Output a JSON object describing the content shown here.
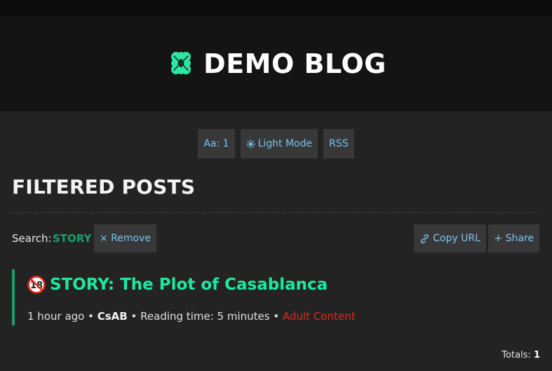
{
  "header": {
    "title": "DEMO BLOG",
    "logo_icon": "clover-icon",
    "logo_color": "#2ee6a4"
  },
  "nav": {
    "font_size": "Aa: 1",
    "light_mode": "Light Mode",
    "light_mode_icon": "sun-icon",
    "rss": "RSS"
  },
  "page": {
    "title": "FILTERED POSTS"
  },
  "search": {
    "label": "Search:",
    "term": "STORY",
    "remove_label": "× Remove",
    "copy_url_label": "Copy URL",
    "copy_url_icon": "link-icon",
    "share_label": "+ Share"
  },
  "posts": [
    {
      "title": "STORY: The Plot of Casablanca",
      "badge_icon": "adult-18-icon",
      "time": "1 hour ago",
      "sep1": "•",
      "author": "CsAB",
      "sep2": "•",
      "reading_time": "Reading time: 5 minutes",
      "sep3": "•",
      "tag": "Adult Content"
    }
  ],
  "totals": {
    "label": "Totals:",
    "count": "1"
  },
  "colors": {
    "accent": "#1ee8a0",
    "accent_dark": "#1f9d6e",
    "link": "#7cc4ef",
    "adult": "#e0281a"
  }
}
